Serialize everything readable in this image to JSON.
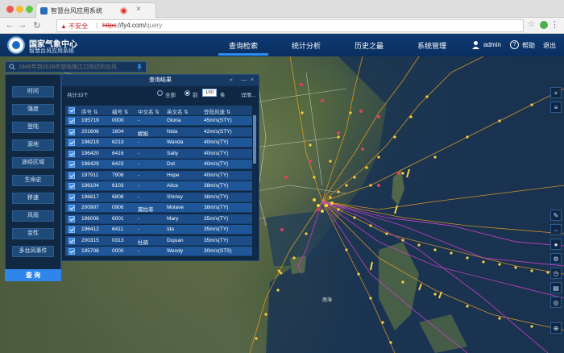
{
  "browser": {
    "tab_title": "智慧台风应用系统",
    "url_warning": "不安全",
    "url_scheme": "https",
    "url_host": "://fy4.com/",
    "url_path": "query"
  },
  "app": {
    "title": "国家气象中心",
    "subtitle": "智慧台风应用系统",
    "nav": [
      {
        "label": "查询检索"
      },
      {
        "label": "统计分析"
      },
      {
        "label": "历史之最"
      },
      {
        "label": "系统管理"
      }
    ],
    "user": "admin",
    "help": "帮助",
    "logout": "退出"
  },
  "search": {
    "placeholder": "1949年到2016年登陆珠江口附近的台风"
  },
  "filters": [
    "时间",
    "强度",
    "登陆",
    "源地",
    "途经区域",
    "生命史",
    "移速",
    "风雨",
    "变性",
    "多台风事件"
  ],
  "query_button": "查 询",
  "results": {
    "title": "查询结果",
    "count_text": "共计33个",
    "all_label": "全部",
    "per_label_pre": "前",
    "per_value": "100",
    "per_label_post": "条",
    "detail": "详情...",
    "columns": [
      "序号",
      "编号",
      "中文名",
      "英文名",
      "登陆风速"
    ],
    "rows": [
      [
        "195719",
        "0000",
        "-",
        "Gloria",
        "45m/s(STY)"
      ],
      [
        "201606",
        "1604",
        "妮妲",
        "Nida",
        "42m/s(STY)"
      ],
      [
        "196219",
        "6213",
        "-",
        "Wanda",
        "40m/s(TY)"
      ],
      [
        "196420",
        "6416",
        "-",
        "Sally",
        "40m/s(TY)"
      ],
      [
        "196429",
        "6423",
        "-",
        "Dot",
        "40m/s(TY)"
      ],
      [
        "197911",
        "7908",
        "-",
        "Hope",
        "40m/s(TY)"
      ],
      [
        "196104",
        "6103",
        "-",
        "Alice",
        "38m/s(TY)"
      ],
      [
        "196817",
        "6808",
        "-",
        "Shirley",
        "38m/s(TY)"
      ],
      [
        "200907",
        "0906",
        "莫拉菲",
        "Molave",
        "38m/s(TY)"
      ],
      [
        "196006",
        "6001",
        "-",
        "Mary",
        "35m/s(TY)"
      ],
      [
        "196412",
        "6411",
        "-",
        "Ida",
        "35m/s(TY)"
      ],
      [
        "200315",
        "0313",
        "杜鹃",
        "Dujuan",
        "35m/s(TY)"
      ],
      [
        "195708",
        "0000",
        "-",
        "Wendy",
        "30m/s(STS)"
      ]
    ]
  },
  "colors": {
    "header": "#0e3a73",
    "accent": "#2d8cf0",
    "track_orange": "#f0a020",
    "track_magenta": "#d040c8",
    "track_yellow": "#ffd23a"
  }
}
